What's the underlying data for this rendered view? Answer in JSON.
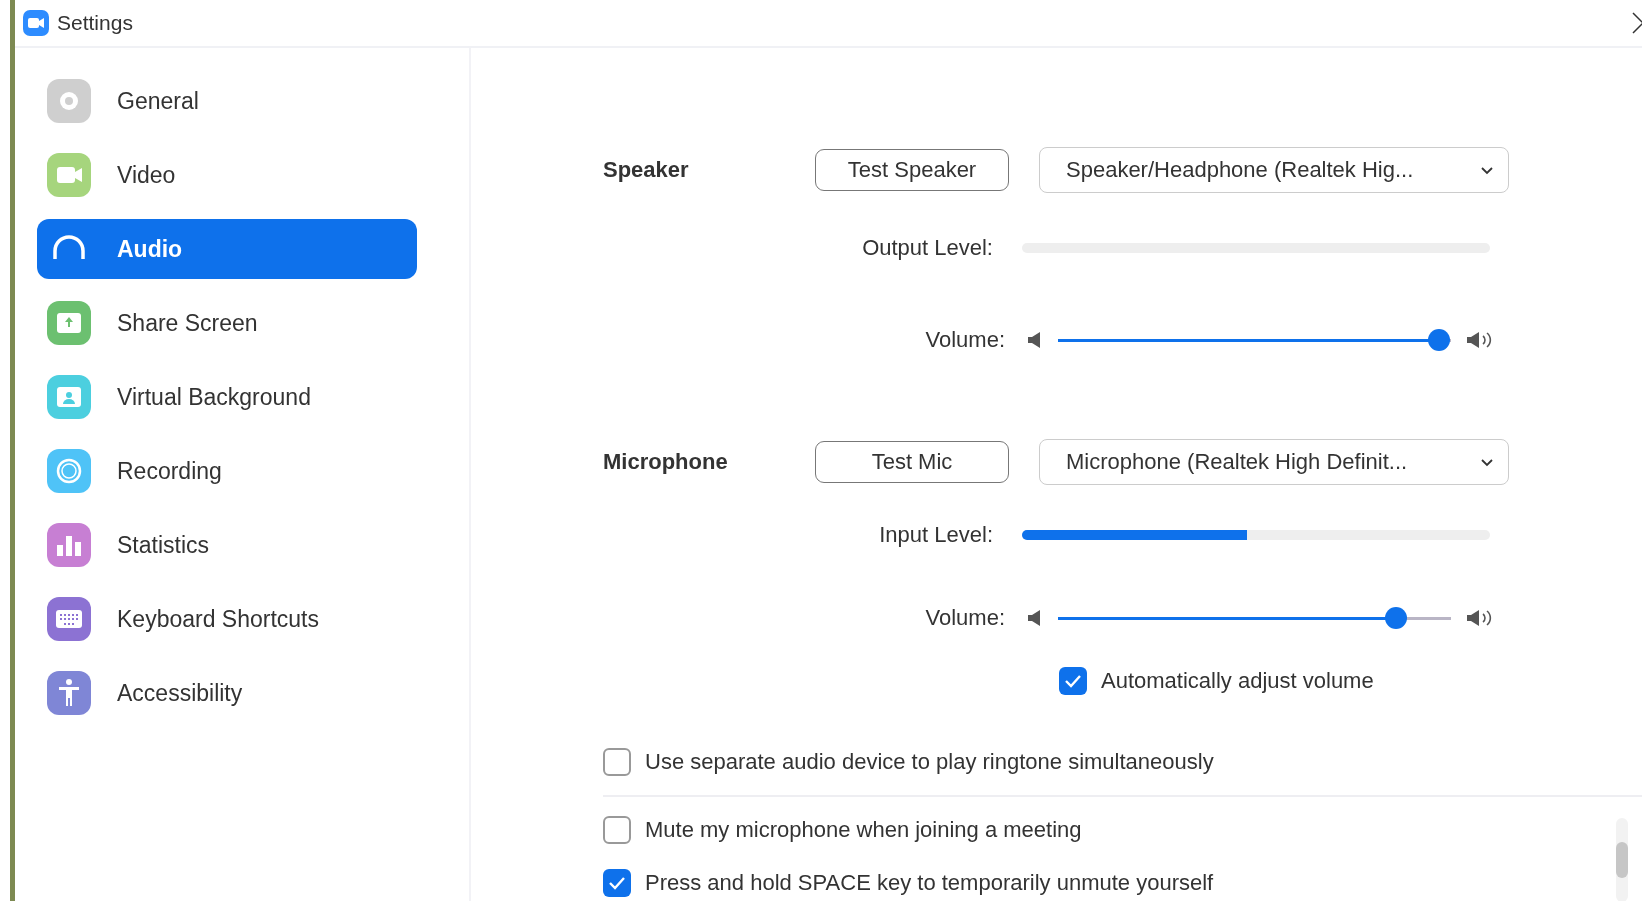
{
  "window": {
    "title": "Settings"
  },
  "sidebar": {
    "items": [
      {
        "label": "General",
        "selected": false,
        "color": "#cfcfcf"
      },
      {
        "label": "Video",
        "selected": false,
        "color": "#a6d57d"
      },
      {
        "label": "Audio",
        "selected": true
      },
      {
        "label": "Share Screen",
        "selected": false,
        "color": "#6cc070"
      },
      {
        "label": "Virtual Background",
        "selected": false,
        "color": "#4ccfdf"
      },
      {
        "label": "Recording",
        "selected": false,
        "color": "#4fc3f7"
      },
      {
        "label": "Statistics",
        "selected": false,
        "color": "#c77fd3"
      },
      {
        "label": "Keyboard Shortcuts",
        "selected": false,
        "color": "#8c72d3"
      },
      {
        "label": "Accessibility",
        "selected": false,
        "color": "#7f86d6"
      }
    ]
  },
  "speaker": {
    "heading": "Speaker",
    "test_button": "Test Speaker",
    "device": "Speaker/Headphone (Realtek Hig...",
    "level_label": "Output Level:",
    "level": 0,
    "volume_label": "Volume:",
    "volume": {
      "level": 0.97
    }
  },
  "microphone": {
    "heading": "Microphone",
    "test_button": "Test Mic",
    "device": "Microphone (Realtek High Definit...",
    "level_label": "Input Level:",
    "level": 0.48,
    "volume_label": "Volume:",
    "volume": {
      "level": 0.86
    },
    "auto_adjust": {
      "label": "Automatically adjust volume",
      "checked": true
    }
  },
  "options": [
    {
      "label": "Use separate audio device to play ringtone simultaneously",
      "checked": false
    },
    {
      "label": "Mute my microphone when joining a meeting",
      "checked": false
    },
    {
      "label": "Press and hold SPACE key to temporarily unmute yourself",
      "checked": true
    }
  ]
}
